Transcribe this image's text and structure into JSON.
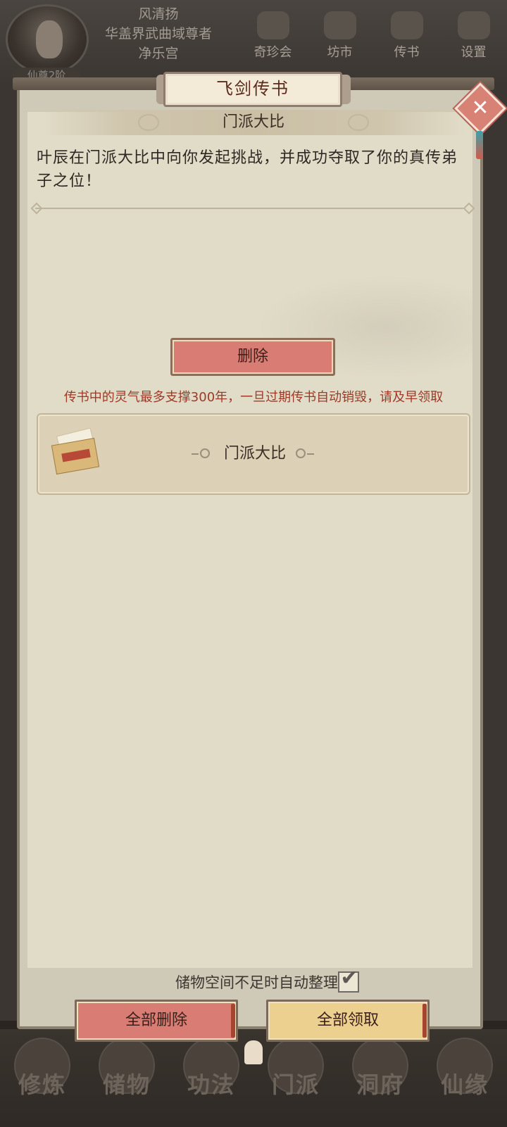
{
  "background": {
    "player": {
      "name": "风清扬",
      "title": "华盖界武曲域尊者",
      "sect": "净乐宫",
      "rank": "仙尊2阶"
    },
    "top_nav": [
      {
        "label": "奇珍会",
        "icon": "treasure-icon"
      },
      {
        "label": "坊市",
        "icon": "market-icon"
      },
      {
        "label": "传书",
        "icon": "letter-icon"
      },
      {
        "label": "设置",
        "icon": "gear-icon"
      }
    ],
    "bottom_nav": [
      {
        "label": "修炼"
      },
      {
        "label": "储物"
      },
      {
        "label": "功法"
      },
      {
        "label": "门派"
      },
      {
        "label": "洞府"
      },
      {
        "label": "仙缘"
      }
    ]
  },
  "modal": {
    "title": "飞剑传书",
    "close_icon": "close-icon",
    "detail": {
      "title": "门派大比",
      "body": "叶辰在门派大比中向你发起挑战，并成功夺取了你的真传弟子之位！",
      "delete_label": "删除"
    },
    "expiry_notice": "传书中的灵气最多支撑300年，一旦过期传书自动销毁，请及早领取",
    "mail_list": [
      {
        "title": "门派大比",
        "icon": "letter-scroll-icon"
      }
    ],
    "auto_sort_label": "储物空间不足时自动整理",
    "auto_sort_checked": true,
    "delete_all_label": "全部删除",
    "claim_all_label": "全部领取"
  },
  "colors": {
    "delete_button": "#d97c74",
    "claim_button": "#ecd08f",
    "notice_text": "#9c3a27",
    "panel": "#e1dcc8"
  }
}
